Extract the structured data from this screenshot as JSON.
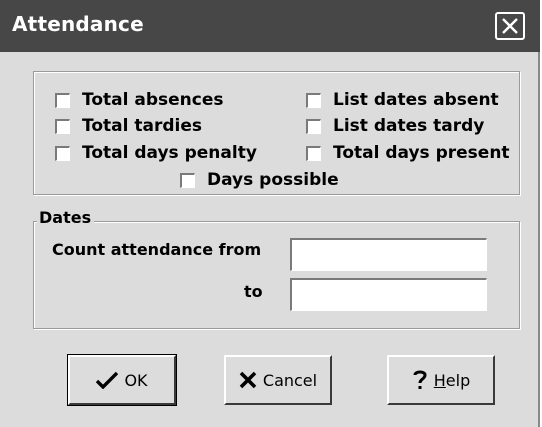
{
  "window": {
    "title": "Attendance"
  },
  "options": {
    "total_absences": "Total absences",
    "total_tardies": "Total tardies",
    "total_days_penalty": "Total days penalty",
    "list_dates_absent": "List dates absent",
    "list_dates_tardy": "List dates tardy",
    "total_days_present": "Total days present",
    "days_possible": "Days possible"
  },
  "dates": {
    "group_label": "Dates",
    "from_label": "Count attendance from",
    "to_label": "to",
    "from_value": "",
    "to_value": ""
  },
  "buttons": {
    "ok": "OK",
    "cancel": "Cancel",
    "help": "Help"
  },
  "icons": {
    "close": "close-icon",
    "ok": "checkmark-icon",
    "cancel": "x-icon",
    "help": "question-mark-icon"
  },
  "colors": {
    "title_bar": "#474747",
    "dialog_bg": "#dcdcdc"
  }
}
